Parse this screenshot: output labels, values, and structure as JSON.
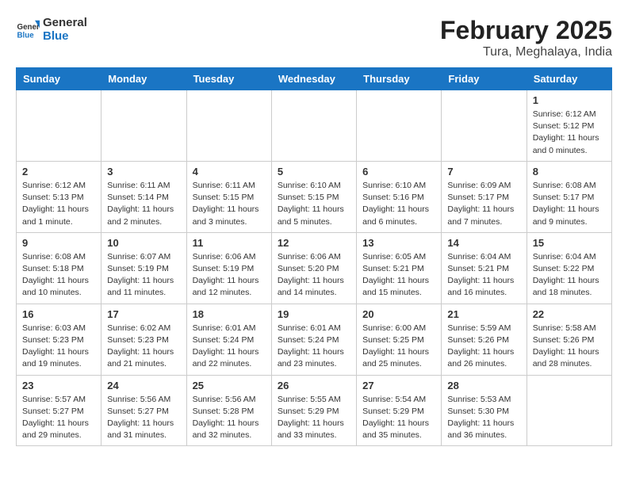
{
  "logo": {
    "line1": "General",
    "line2": "Blue"
  },
  "title": "February 2025",
  "subtitle": "Tura, Meghalaya, India",
  "weekdays": [
    "Sunday",
    "Monday",
    "Tuesday",
    "Wednesday",
    "Thursday",
    "Friday",
    "Saturday"
  ],
  "weeks": [
    [
      {
        "day": "",
        "info": ""
      },
      {
        "day": "",
        "info": ""
      },
      {
        "day": "",
        "info": ""
      },
      {
        "day": "",
        "info": ""
      },
      {
        "day": "",
        "info": ""
      },
      {
        "day": "",
        "info": ""
      },
      {
        "day": "1",
        "info": "Sunrise: 6:12 AM\nSunset: 5:12 PM\nDaylight: 11 hours and 0 minutes."
      }
    ],
    [
      {
        "day": "2",
        "info": "Sunrise: 6:12 AM\nSunset: 5:13 PM\nDaylight: 11 hours and 1 minute."
      },
      {
        "day": "3",
        "info": "Sunrise: 6:11 AM\nSunset: 5:14 PM\nDaylight: 11 hours and 2 minutes."
      },
      {
        "day": "4",
        "info": "Sunrise: 6:11 AM\nSunset: 5:15 PM\nDaylight: 11 hours and 3 minutes."
      },
      {
        "day": "5",
        "info": "Sunrise: 6:10 AM\nSunset: 5:15 PM\nDaylight: 11 hours and 5 minutes."
      },
      {
        "day": "6",
        "info": "Sunrise: 6:10 AM\nSunset: 5:16 PM\nDaylight: 11 hours and 6 minutes."
      },
      {
        "day": "7",
        "info": "Sunrise: 6:09 AM\nSunset: 5:17 PM\nDaylight: 11 hours and 7 minutes."
      },
      {
        "day": "8",
        "info": "Sunrise: 6:08 AM\nSunset: 5:17 PM\nDaylight: 11 hours and 9 minutes."
      }
    ],
    [
      {
        "day": "9",
        "info": "Sunrise: 6:08 AM\nSunset: 5:18 PM\nDaylight: 11 hours and 10 minutes."
      },
      {
        "day": "10",
        "info": "Sunrise: 6:07 AM\nSunset: 5:19 PM\nDaylight: 11 hours and 11 minutes."
      },
      {
        "day": "11",
        "info": "Sunrise: 6:06 AM\nSunset: 5:19 PM\nDaylight: 11 hours and 12 minutes."
      },
      {
        "day": "12",
        "info": "Sunrise: 6:06 AM\nSunset: 5:20 PM\nDaylight: 11 hours and 14 minutes."
      },
      {
        "day": "13",
        "info": "Sunrise: 6:05 AM\nSunset: 5:21 PM\nDaylight: 11 hours and 15 minutes."
      },
      {
        "day": "14",
        "info": "Sunrise: 6:04 AM\nSunset: 5:21 PM\nDaylight: 11 hours and 16 minutes."
      },
      {
        "day": "15",
        "info": "Sunrise: 6:04 AM\nSunset: 5:22 PM\nDaylight: 11 hours and 18 minutes."
      }
    ],
    [
      {
        "day": "16",
        "info": "Sunrise: 6:03 AM\nSunset: 5:23 PM\nDaylight: 11 hours and 19 minutes."
      },
      {
        "day": "17",
        "info": "Sunrise: 6:02 AM\nSunset: 5:23 PM\nDaylight: 11 hours and 21 minutes."
      },
      {
        "day": "18",
        "info": "Sunrise: 6:01 AM\nSunset: 5:24 PM\nDaylight: 11 hours and 22 minutes."
      },
      {
        "day": "19",
        "info": "Sunrise: 6:01 AM\nSunset: 5:24 PM\nDaylight: 11 hours and 23 minutes."
      },
      {
        "day": "20",
        "info": "Sunrise: 6:00 AM\nSunset: 5:25 PM\nDaylight: 11 hours and 25 minutes."
      },
      {
        "day": "21",
        "info": "Sunrise: 5:59 AM\nSunset: 5:26 PM\nDaylight: 11 hours and 26 minutes."
      },
      {
        "day": "22",
        "info": "Sunrise: 5:58 AM\nSunset: 5:26 PM\nDaylight: 11 hours and 28 minutes."
      }
    ],
    [
      {
        "day": "23",
        "info": "Sunrise: 5:57 AM\nSunset: 5:27 PM\nDaylight: 11 hours and 29 minutes."
      },
      {
        "day": "24",
        "info": "Sunrise: 5:56 AM\nSunset: 5:27 PM\nDaylight: 11 hours and 31 minutes."
      },
      {
        "day": "25",
        "info": "Sunrise: 5:56 AM\nSunset: 5:28 PM\nDaylight: 11 hours and 32 minutes."
      },
      {
        "day": "26",
        "info": "Sunrise: 5:55 AM\nSunset: 5:29 PM\nDaylight: 11 hours and 33 minutes."
      },
      {
        "day": "27",
        "info": "Sunrise: 5:54 AM\nSunset: 5:29 PM\nDaylight: 11 hours and 35 minutes."
      },
      {
        "day": "28",
        "info": "Sunrise: 5:53 AM\nSunset: 5:30 PM\nDaylight: 11 hours and 36 minutes."
      },
      {
        "day": "",
        "info": ""
      }
    ]
  ]
}
